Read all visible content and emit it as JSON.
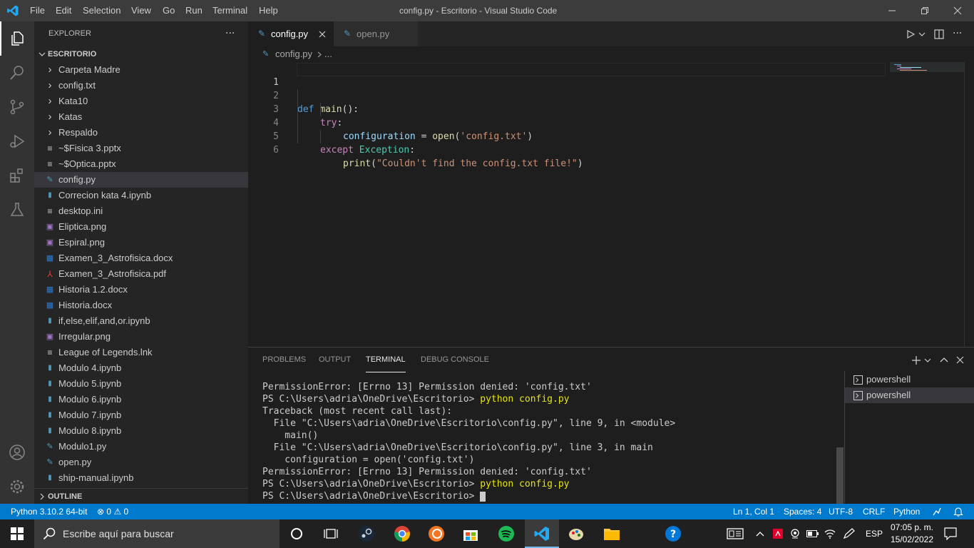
{
  "titlebar": {
    "menu": [
      "File",
      "Edit",
      "Selection",
      "View",
      "Go",
      "Run",
      "Terminal",
      "Help"
    ],
    "window_title": "config.py - Escritorio - Visual Studio Code"
  },
  "sidebar": {
    "title": "EXPLORER",
    "more": "···",
    "folder": "ESCRITORIO",
    "items": [
      {
        "label": "Carpeta Madre",
        "icon": "chevron-right-icon"
      },
      {
        "label": "config.txt",
        "icon": "chevron-right-icon"
      },
      {
        "label": "Kata10",
        "icon": "chevron-right-icon"
      },
      {
        "label": "Katas",
        "icon": "chevron-right-icon"
      },
      {
        "label": "Respaldo",
        "icon": "chevron-right-icon"
      },
      {
        "label": "~$Fisica 3.pptx",
        "icon": "lines-file-icon"
      },
      {
        "label": "~$Optica.pptx",
        "icon": "lines-file-icon"
      },
      {
        "label": "config.py",
        "icon": "python-file-icon"
      },
      {
        "label": "Correcion kata 4.ipynb",
        "icon": "notebook-file-icon"
      },
      {
        "label": "desktop.ini",
        "icon": "lines-file-icon"
      },
      {
        "label": "Eliptica.png",
        "icon": "image-file-icon"
      },
      {
        "label": "Espiral.png",
        "icon": "image-file-icon"
      },
      {
        "label": "Examen_3_Astrofisica.docx",
        "icon": "word-file-icon"
      },
      {
        "label": "Examen_3_Astrofisica.pdf",
        "icon": "pdf-file-icon"
      },
      {
        "label": "Historia 1.2.docx",
        "icon": "word-file-icon"
      },
      {
        "label": "Historia.docx",
        "icon": "word-file-icon"
      },
      {
        "label": "if,else,elif,and,or.ipynb",
        "icon": "notebook-file-icon"
      },
      {
        "label": "Irregular.png",
        "icon": "image-file-icon"
      },
      {
        "label": "League of Legends.lnk",
        "icon": "lines-file-icon"
      },
      {
        "label": "Modulo 4.ipynb",
        "icon": "notebook-file-icon"
      },
      {
        "label": "Modulo 5.ipynb",
        "icon": "notebook-file-icon"
      },
      {
        "label": "Modulo 6.ipynb",
        "icon": "notebook-file-icon"
      },
      {
        "label": "Modulo 7.ipynb",
        "icon": "notebook-file-icon"
      },
      {
        "label": "Modulo 8.ipynb",
        "icon": "notebook-file-icon"
      },
      {
        "label": "Modulo1.py",
        "icon": "python-file-icon"
      },
      {
        "label": "open.py",
        "icon": "python-file-icon"
      },
      {
        "label": "ship-manual.ipynb",
        "icon": "notebook-file-icon"
      }
    ],
    "selected_index": 7,
    "outline": "OUTLINE"
  },
  "editor": {
    "tabs": [
      {
        "label": "config.py",
        "active": true
      },
      {
        "label": "open.py",
        "active": false
      }
    ],
    "breadcrumb": {
      "file": "config.py",
      "rest": "..."
    },
    "line_numbers": [
      "1",
      "2",
      "3",
      "4",
      "5",
      "6"
    ],
    "code": {
      "l2": {
        "kw": "def",
        "fn": "main",
        "rest": "():"
      },
      "l3": {
        "kw": "try",
        "rest": ":"
      },
      "l4": {
        "var": "configuration",
        "op": " = ",
        "fn": "open",
        "p1": "(",
        "str": "'config.txt'",
        "p2": ")"
      },
      "l5": {
        "kw": "except",
        "cls": "Exception",
        "rest": ":"
      },
      "l6": {
        "fn": "print",
        "p1": "(",
        "str": "\"Couldn't find the config.txt file!\"",
        "p2": ")"
      }
    }
  },
  "panel": {
    "tabs": [
      "PROBLEMS",
      "OUTPUT",
      "TERMINAL",
      "DEBUG CONSOLE"
    ],
    "active_tab": "TERMINAL",
    "terminal_lines": [
      {
        "text": "PermissionError: [Errno 13] Permission denied: 'config.txt'",
        "cmd": ""
      },
      {
        "text": "PS C:\\Users\\adria\\OneDrive\\Escritorio> ",
        "cmd": "python config.py"
      },
      {
        "text": "Traceback (most recent call last):",
        "cmd": ""
      },
      {
        "text": "  File \"C:\\Users\\adria\\OneDrive\\Escritorio\\config.py\", line 9, in <module>",
        "cmd": ""
      },
      {
        "text": "    main()",
        "cmd": ""
      },
      {
        "text": "  File \"C:\\Users\\adria\\OneDrive\\Escritorio\\config.py\", line 3, in main",
        "cmd": ""
      },
      {
        "text": "    configuration = open('config.txt')",
        "cmd": ""
      },
      {
        "text": "PermissionError: [Errno 13] Permission denied: 'config.txt'",
        "cmd": ""
      },
      {
        "text": "PS C:\\Users\\adria\\OneDrive\\Escritorio> ",
        "cmd": "python config.py"
      }
    ],
    "prompt": "PS C:\\Users\\adria\\OneDrive\\Escritorio> ",
    "terminals": [
      "powershell",
      "powershell"
    ]
  },
  "statusbar": {
    "python": "Python 3.10.2 64-bit",
    "errors": "0",
    "warnings": "0",
    "position": "Ln 1, Col 1",
    "spaces": "Spaces: 4",
    "encoding": "UTF-8",
    "eol": "CRLF",
    "language": "Python"
  },
  "taskbar": {
    "search_placeholder": "Escribe aquí para buscar",
    "lang": "ESP",
    "time": "07:05 p. m.",
    "date": "15/02/2022"
  },
  "colors": {
    "accent": "#007acc",
    "titlebar": "#3c3c3c",
    "activitybar": "#333333",
    "sidebar": "#252526",
    "editor": "#1e1e1e"
  }
}
